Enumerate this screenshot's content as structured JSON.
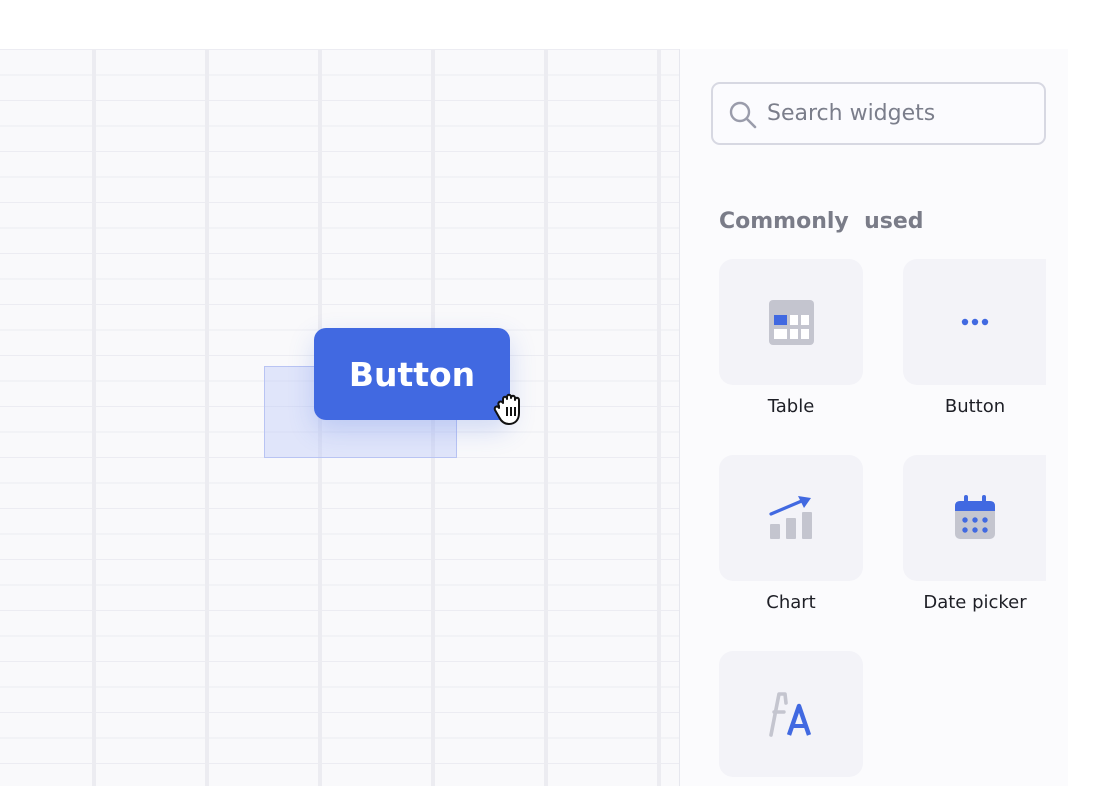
{
  "canvas": {
    "dragged_widget_label": "Button"
  },
  "panel": {
    "search": {
      "placeholder": "Search widgets"
    },
    "section_title": "Commonly  used",
    "widgets": [
      {
        "label": "Table",
        "icon": "table-icon"
      },
      {
        "label": "Button",
        "icon": "ellipsis-icon"
      },
      {
        "label": "Chart",
        "icon": "chart-icon"
      },
      {
        "label": "Date picker",
        "icon": "calendar-icon"
      },
      {
        "label": "",
        "icon": "text-icon"
      }
    ]
  },
  "colors": {
    "accent": "#4169e1",
    "tile_background": "#f3f3f8",
    "icon_gray": "#c4c5cf"
  }
}
